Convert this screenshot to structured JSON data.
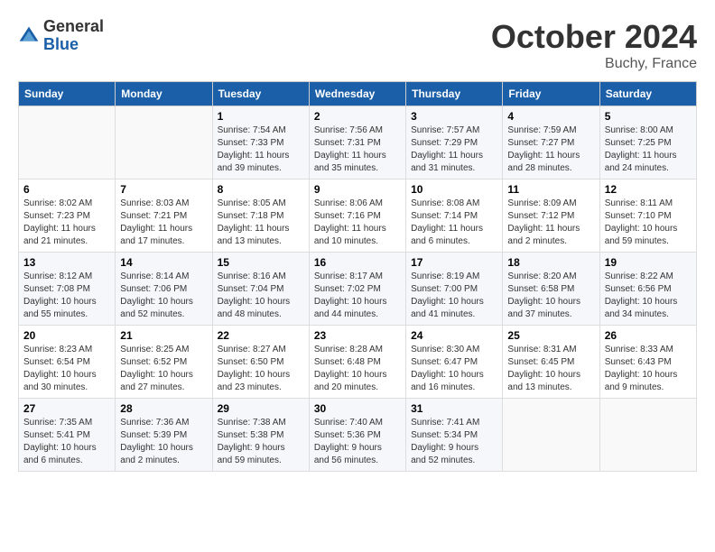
{
  "header": {
    "logo_general": "General",
    "logo_blue": "Blue",
    "month_title": "October 2024",
    "location": "Buchy, France"
  },
  "weekdays": [
    "Sunday",
    "Monday",
    "Tuesday",
    "Wednesday",
    "Thursday",
    "Friday",
    "Saturday"
  ],
  "weeks": [
    [
      {
        "day": "",
        "info": ""
      },
      {
        "day": "",
        "info": ""
      },
      {
        "day": "1",
        "info": "Sunrise: 7:54 AM\nSunset: 7:33 PM\nDaylight: 11 hours\nand 39 minutes."
      },
      {
        "day": "2",
        "info": "Sunrise: 7:56 AM\nSunset: 7:31 PM\nDaylight: 11 hours\nand 35 minutes."
      },
      {
        "day": "3",
        "info": "Sunrise: 7:57 AM\nSunset: 7:29 PM\nDaylight: 11 hours\nand 31 minutes."
      },
      {
        "day": "4",
        "info": "Sunrise: 7:59 AM\nSunset: 7:27 PM\nDaylight: 11 hours\nand 28 minutes."
      },
      {
        "day": "5",
        "info": "Sunrise: 8:00 AM\nSunset: 7:25 PM\nDaylight: 11 hours\nand 24 minutes."
      }
    ],
    [
      {
        "day": "6",
        "info": "Sunrise: 8:02 AM\nSunset: 7:23 PM\nDaylight: 11 hours\nand 21 minutes."
      },
      {
        "day": "7",
        "info": "Sunrise: 8:03 AM\nSunset: 7:21 PM\nDaylight: 11 hours\nand 17 minutes."
      },
      {
        "day": "8",
        "info": "Sunrise: 8:05 AM\nSunset: 7:18 PM\nDaylight: 11 hours\nand 13 minutes."
      },
      {
        "day": "9",
        "info": "Sunrise: 8:06 AM\nSunset: 7:16 PM\nDaylight: 11 hours\nand 10 minutes."
      },
      {
        "day": "10",
        "info": "Sunrise: 8:08 AM\nSunset: 7:14 PM\nDaylight: 11 hours\nand 6 minutes."
      },
      {
        "day": "11",
        "info": "Sunrise: 8:09 AM\nSunset: 7:12 PM\nDaylight: 11 hours\nand 2 minutes."
      },
      {
        "day": "12",
        "info": "Sunrise: 8:11 AM\nSunset: 7:10 PM\nDaylight: 10 hours\nand 59 minutes."
      }
    ],
    [
      {
        "day": "13",
        "info": "Sunrise: 8:12 AM\nSunset: 7:08 PM\nDaylight: 10 hours\nand 55 minutes."
      },
      {
        "day": "14",
        "info": "Sunrise: 8:14 AM\nSunset: 7:06 PM\nDaylight: 10 hours\nand 52 minutes."
      },
      {
        "day": "15",
        "info": "Sunrise: 8:16 AM\nSunset: 7:04 PM\nDaylight: 10 hours\nand 48 minutes."
      },
      {
        "day": "16",
        "info": "Sunrise: 8:17 AM\nSunset: 7:02 PM\nDaylight: 10 hours\nand 44 minutes."
      },
      {
        "day": "17",
        "info": "Sunrise: 8:19 AM\nSunset: 7:00 PM\nDaylight: 10 hours\nand 41 minutes."
      },
      {
        "day": "18",
        "info": "Sunrise: 8:20 AM\nSunset: 6:58 PM\nDaylight: 10 hours\nand 37 minutes."
      },
      {
        "day": "19",
        "info": "Sunrise: 8:22 AM\nSunset: 6:56 PM\nDaylight: 10 hours\nand 34 minutes."
      }
    ],
    [
      {
        "day": "20",
        "info": "Sunrise: 8:23 AM\nSunset: 6:54 PM\nDaylight: 10 hours\nand 30 minutes."
      },
      {
        "day": "21",
        "info": "Sunrise: 8:25 AM\nSunset: 6:52 PM\nDaylight: 10 hours\nand 27 minutes."
      },
      {
        "day": "22",
        "info": "Sunrise: 8:27 AM\nSunset: 6:50 PM\nDaylight: 10 hours\nand 23 minutes."
      },
      {
        "day": "23",
        "info": "Sunrise: 8:28 AM\nSunset: 6:48 PM\nDaylight: 10 hours\nand 20 minutes."
      },
      {
        "day": "24",
        "info": "Sunrise: 8:30 AM\nSunset: 6:47 PM\nDaylight: 10 hours\nand 16 minutes."
      },
      {
        "day": "25",
        "info": "Sunrise: 8:31 AM\nSunset: 6:45 PM\nDaylight: 10 hours\nand 13 minutes."
      },
      {
        "day": "26",
        "info": "Sunrise: 8:33 AM\nSunset: 6:43 PM\nDaylight: 10 hours\nand 9 minutes."
      }
    ],
    [
      {
        "day": "27",
        "info": "Sunrise: 7:35 AM\nSunset: 5:41 PM\nDaylight: 10 hours\nand 6 minutes."
      },
      {
        "day": "28",
        "info": "Sunrise: 7:36 AM\nSunset: 5:39 PM\nDaylight: 10 hours\nand 2 minutes."
      },
      {
        "day": "29",
        "info": "Sunrise: 7:38 AM\nSunset: 5:38 PM\nDaylight: 9 hours\nand 59 minutes."
      },
      {
        "day": "30",
        "info": "Sunrise: 7:40 AM\nSunset: 5:36 PM\nDaylight: 9 hours\nand 56 minutes."
      },
      {
        "day": "31",
        "info": "Sunrise: 7:41 AM\nSunset: 5:34 PM\nDaylight: 9 hours\nand 52 minutes."
      },
      {
        "day": "",
        "info": ""
      },
      {
        "day": "",
        "info": ""
      }
    ]
  ]
}
